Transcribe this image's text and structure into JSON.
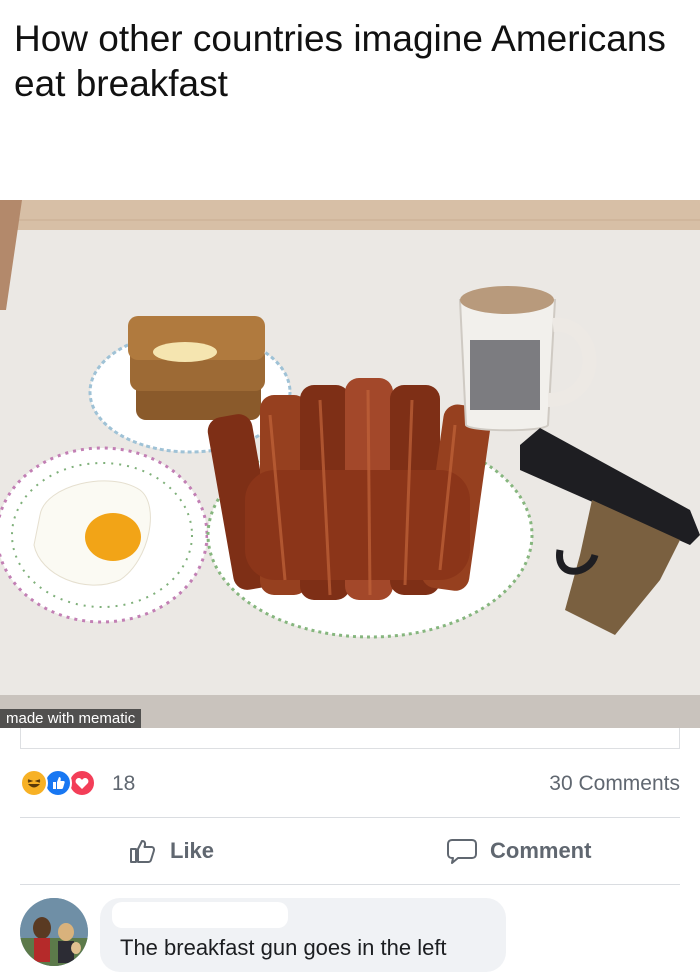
{
  "meme": {
    "caption": "How other countries imagine Americans eat breakfast",
    "watermark": "made with mematic"
  },
  "post_stats": {
    "reactions": [
      "haha-icon",
      "like-icon",
      "love-icon"
    ],
    "reaction_count": "18",
    "comments_label": "30 Comments"
  },
  "actions": {
    "like_label": "Like",
    "comment_label": "Comment"
  },
  "comment": {
    "author_name": "",
    "text": "The breakfast gun goes in the left"
  },
  "colors": {
    "like_blue": "#1877f2",
    "love_red": "#f33e58",
    "haha_yellow": "#f7b125",
    "text_gray": "#606770",
    "bubble_bg": "#f0f2f5"
  }
}
